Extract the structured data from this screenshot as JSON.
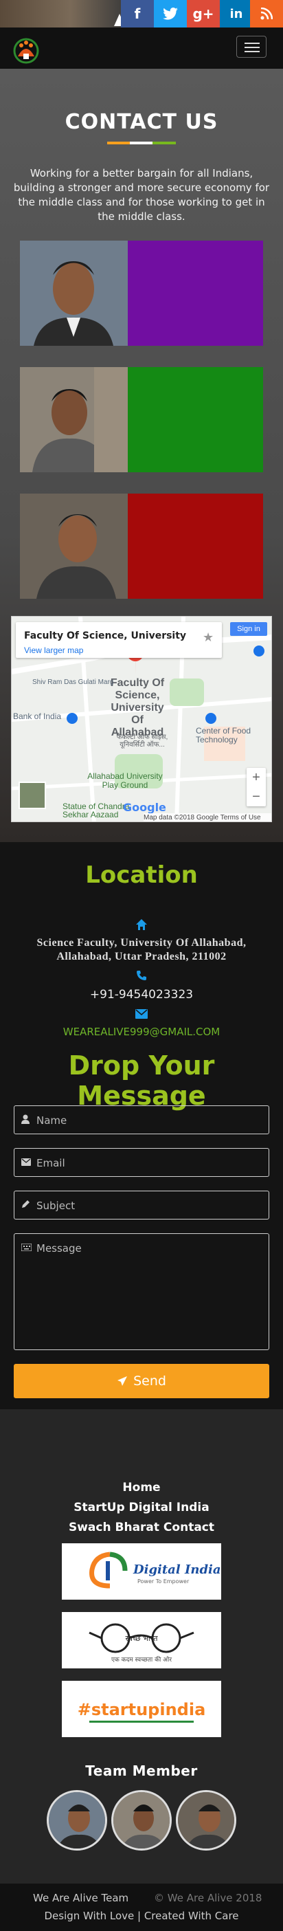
{
  "social": {
    "facebook": "f",
    "twitter": "",
    "googleplus": "g+",
    "linkedin": "in",
    "rss": ""
  },
  "contact": {
    "title": "CONTACT US",
    "intro": "Working for a better bargain for all Indians, building a stronger and more secure economy for the middle class and for those working to get in the middle class.",
    "members": [
      {
        "color": "#710ea1"
      },
      {
        "color": "#148a14"
      },
      {
        "color": "#a50a0a"
      }
    ]
  },
  "map": {
    "card_title": "Faculty Of Science, University Of All...",
    "card_link": "View larger map",
    "signin": "Sign in",
    "place": "Faculty Of Science, University Of Allahabad",
    "place_hi": "फैकल्टी ऑफ साइंस, यूनिवर्सिटी ऑफ...",
    "labels": [
      "Bank of India",
      "Center of Food Technology",
      "Allahabad University Play Ground",
      "Statue of Chandra Sekhar Aazaad",
      "Shiv Ram Das Gulati Marg"
    ],
    "google": "Google",
    "attribution": "Map data ©2018 Google   Terms of Use"
  },
  "location": {
    "title": "Location",
    "address": "Science Faculty, University Of Allahabad, Allahabad, Uttar Pradesh, 211002",
    "phone": "+91-9454023323",
    "email": "wearealive999@gmail.com"
  },
  "form": {
    "title": "Drop Your Message",
    "name_ph": "Name",
    "email_ph": "Email",
    "subject_ph": "Subject",
    "message_ph": "Message",
    "send": "Send"
  },
  "footer": {
    "links": [
      "Home",
      "StartUp Digital India",
      "Swach Bharat Contact"
    ],
    "badges": [
      "Digital India",
      "स्वच्छ भारत",
      "#startupindia"
    ],
    "badge_sub": [
      "Power To Empower",
      "एक कदम स्वच्छता की ओर"
    ],
    "team_title": "Team Member",
    "copy_left": "We Are Alive Team",
    "copy_right": "© We Are Alive 2018",
    "copy_line2": "Design With Love | Created With Care"
  },
  "colors": {
    "accent_green": "#9bc31f",
    "accent_orange": "#f7a01e",
    "link_blue": "#1b9be8"
  }
}
